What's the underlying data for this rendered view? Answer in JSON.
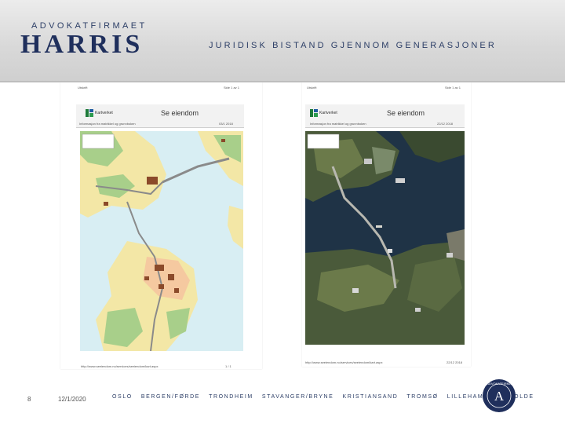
{
  "header": {
    "firm_sub": "ADVOKATFIRMAET",
    "firm_name": "HARRIS",
    "tagline": "JURIDISK BISTAND GJENNOM GENERASJONER"
  },
  "documents": {
    "left": {
      "top_left": "Utskrift",
      "top_right": "Side 1 av 1",
      "logo": "Kartverket",
      "title": "Se eiendom",
      "subtitle": "Informasjon fra matrikkel og grunnboken",
      "date": "03/1 2018",
      "url": "http://www.seeiendom.no/services/seeiendom/kart.aspx",
      "page": "1 / 1"
    },
    "right": {
      "top_left": "Utskrift",
      "top_right": "Side 1 av 1",
      "logo": "Kartverket",
      "title": "Se eiendom",
      "subtitle": "Informasjon fra matrikkel og grunnboken",
      "date": "22/12 2018",
      "url": "http://www.seeiendom.no/services/seeiendom/kart.aspx",
      "page": "22/12 2018"
    }
  },
  "footer": {
    "slide_number": "8",
    "date": "12/1/2020",
    "cities": [
      "OSLO",
      "BERGEN/FØRDE",
      "TRONDHEIM",
      "STAVANGER/BRYNE",
      "KRISTIANSAND",
      "TROMSØ",
      "LILLEHAMMER",
      "MOLDE"
    ],
    "seal_letter": "A",
    "seal_text": "ADVOKATFIRMA"
  },
  "colors": {
    "brand_navy": "#1f2f5c",
    "sea_map": "#d8eef3",
    "land_yellow": "#f3e7a6",
    "forest": "#a8cf8a",
    "road": "#8a8a8a",
    "sea_photo": "#1f3346"
  }
}
